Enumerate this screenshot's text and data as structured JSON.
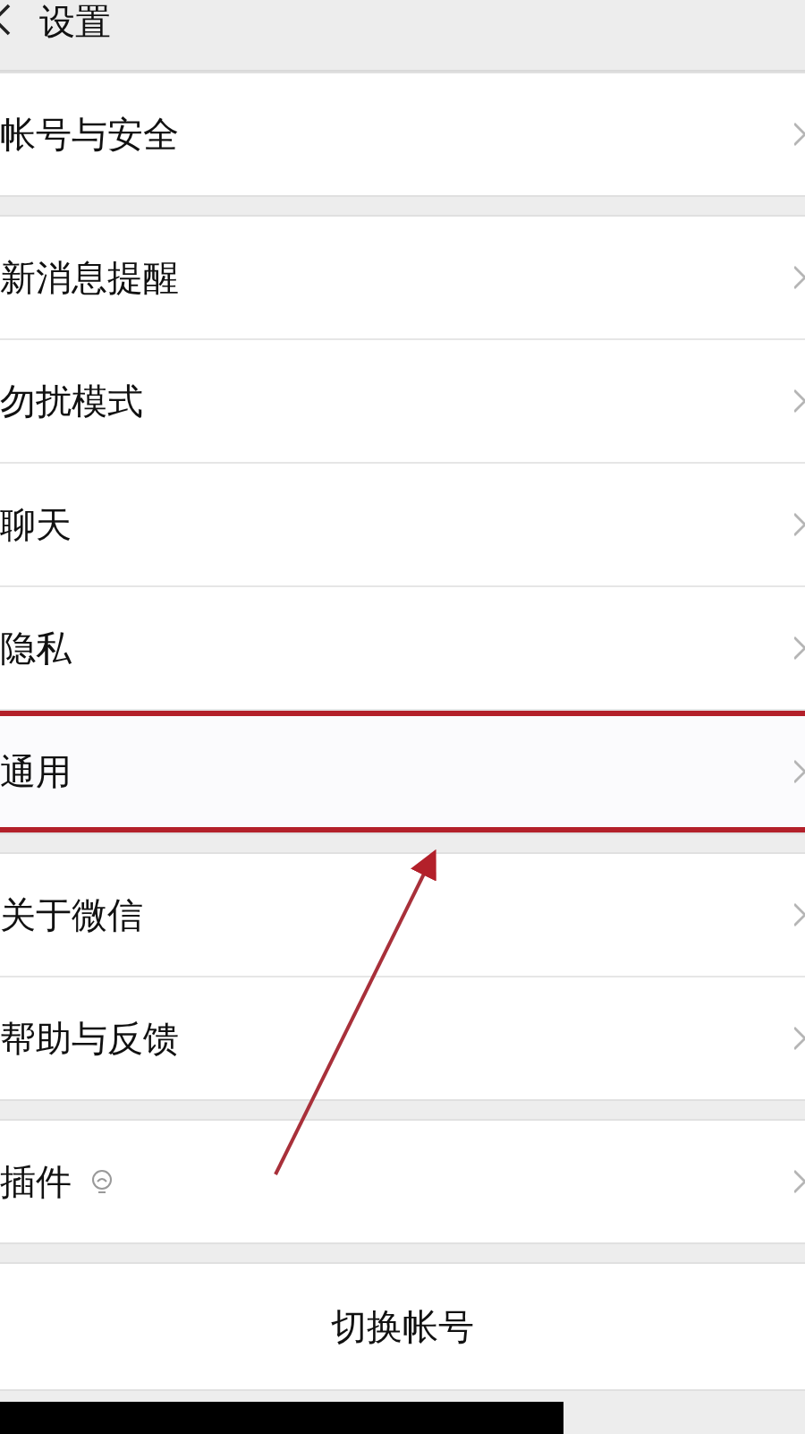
{
  "header": {
    "title": "设置"
  },
  "groups": [
    {
      "items": [
        {
          "label": "帐号与安全",
          "highlighted": false
        }
      ]
    },
    {
      "items": [
        {
          "label": "新消息提醒",
          "highlighted": false
        },
        {
          "label": "勿扰模式",
          "highlighted": false
        },
        {
          "label": "聊天",
          "highlighted": false
        },
        {
          "label": "隐私",
          "highlighted": false
        },
        {
          "label": "通用",
          "highlighted": true
        }
      ]
    },
    {
      "items": [
        {
          "label": "关于微信",
          "highlighted": false
        },
        {
          "label": "帮助与反馈",
          "highlighted": false
        }
      ]
    },
    {
      "items": [
        {
          "label": "插件",
          "highlighted": false,
          "badge": true
        }
      ]
    }
  ],
  "switch_account_button": "切换帐号"
}
